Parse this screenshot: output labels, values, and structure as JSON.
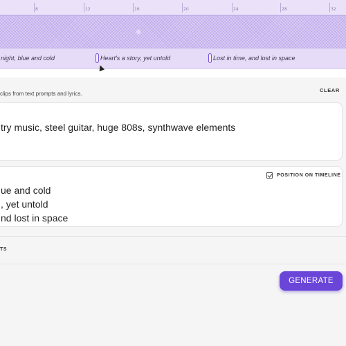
{
  "timeline": {
    "ticks": [
      "8",
      "12",
      "16",
      "20",
      "24",
      "28",
      "32"
    ],
    "lyrics": [
      "night, blue and cold",
      "Heart's a story, yet untold",
      "Lost in time, and lost in space"
    ]
  },
  "panel": {
    "hint": "clips from text prompts and lyrics.",
    "clear_label": "CLEAR",
    "prompt_text": "try music, steel guitar, huge 808s, synthwave elements",
    "lyrics_lines": [
      "ue and cold",
      ", yet untold",
      "nd lost in space"
    ],
    "position_toggle": {
      "label": "POSITION ON TIMELINE",
      "checked": true
    },
    "bottom_label": "TS",
    "generate_label": "GENERATE"
  },
  "colors": {
    "accent": "#6a45d8",
    "marker": "#7b52e0",
    "timeline_bg": "#efe7fb",
    "waveform": "#cdbdf0"
  }
}
